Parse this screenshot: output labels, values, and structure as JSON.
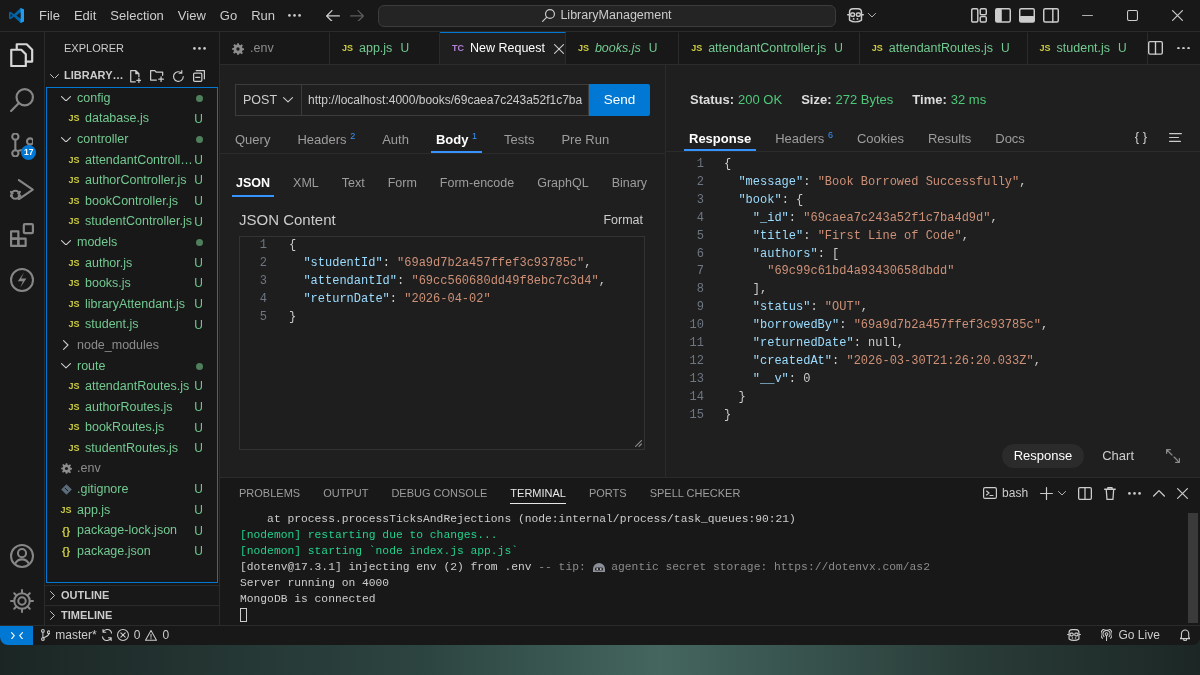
{
  "window": {
    "title": "LibraryManagement"
  },
  "menu": [
    "File",
    "Edit",
    "Selection",
    "View",
    "Go",
    "Run"
  ],
  "nav_buttons": [
    {
      "kind": "back",
      "disabled": false
    },
    {
      "kind": "forward",
      "disabled": true
    }
  ],
  "layout_toggles": [
    {
      "kind": "customize"
    },
    {
      "kind": "primary_sidebar",
      "on": true
    },
    {
      "kind": "panel",
      "on": true
    },
    {
      "kind": "secondary_sidebar",
      "on": false
    }
  ],
  "activity_bar": {
    "items": [
      {
        "kind": "explorer",
        "selected": true
      },
      {
        "kind": "search",
        "selected": false
      },
      {
        "kind": "source_control",
        "selected": false,
        "badge": "17"
      },
      {
        "kind": "run_debug",
        "selected": false
      },
      {
        "kind": "extensions",
        "selected": false
      },
      {
        "kind": "thunder_client",
        "selected": false
      }
    ],
    "bottom": [
      {
        "kind": "account"
      },
      {
        "kind": "settings"
      }
    ]
  },
  "sidebar": {
    "title": "EXPLORER",
    "root": {
      "label": "LIBRARY…",
      "expanded": true,
      "children": [
        {
          "kind": "folder",
          "label": "config",
          "expanded": true,
          "ignored": false,
          "children": [
            {
              "kind": "js",
              "icon": "JS",
              "label": "database.js",
              "ignored": false,
              "badge": "U"
            }
          ]
        },
        {
          "kind": "folder",
          "label": "controller",
          "expanded": true,
          "ignored": false,
          "children": [
            {
              "kind": "js",
              "icon": "JS",
              "label": "attendantControll…",
              "ignored": false,
              "badge": "U"
            },
            {
              "kind": "js",
              "icon": "JS",
              "label": "authorController.js",
              "ignored": false,
              "badge": "U"
            },
            {
              "kind": "js",
              "icon": "JS",
              "label": "bookController.js",
              "ignored": false,
              "badge": "U"
            },
            {
              "kind": "js",
              "icon": "JS",
              "label": "studentController.js",
              "ignored": false,
              "badge": "U"
            }
          ]
        },
        {
          "kind": "folder",
          "label": "models",
          "expanded": true,
          "ignored": false,
          "children": [
            {
              "kind": "js",
              "icon": "JS",
              "label": "author.js",
              "ignored": false,
              "badge": "U"
            },
            {
              "kind": "js",
              "icon": "JS",
              "label": "books.js",
              "ignored": false,
              "badge": "U"
            },
            {
              "kind": "js",
              "icon": "JS",
              "label": "libraryAttendant.js",
              "ignored": false,
              "badge": "U"
            },
            {
              "kind": "js",
              "icon": "JS",
              "label": "student.js",
              "ignored": false,
              "badge": "U"
            }
          ]
        },
        {
          "kind": "folder",
          "label": "node_modules",
          "expanded": false,
          "ignored": true
        },
        {
          "kind": "folder",
          "label": "route",
          "expanded": true,
          "ignored": false,
          "children": [
            {
              "kind": "js",
              "icon": "JS",
              "label": "attendantRoutes.js",
              "ignored": false,
              "badge": "U"
            },
            {
              "kind": "js",
              "icon": "JS",
              "label": "authorRoutes.js",
              "ignored": false,
              "badge": "U"
            },
            {
              "kind": "js",
              "icon": "JS",
              "label": "bookRoutes.js",
              "ignored": false,
              "badge": "U"
            },
            {
              "kind": "js",
              "icon": "JS",
              "label": "studentRoutes.js",
              "ignored": false,
              "badge": "U"
            }
          ]
        },
        {
          "kind": "env",
          "label": ".env",
          "ignored": true
        },
        {
          "kind": "git",
          "label": ".gitignore",
          "ignored": false,
          "badge": "U"
        },
        {
          "kind": "js",
          "icon": "JS",
          "label": "app.js",
          "ignored": false,
          "badge": "U"
        },
        {
          "kind": "json",
          "icon": "{}",
          "label": "package-lock.json",
          "ignored": false,
          "badge": "U"
        },
        {
          "kind": "json",
          "icon": "{}",
          "label": "package.json",
          "ignored": false,
          "badge": "U"
        }
      ]
    },
    "sections": [
      {
        "label": "OUTLINE",
        "expanded": false
      },
      {
        "label": "TIMELINE",
        "expanded": false
      }
    ]
  },
  "tabs": [
    {
      "kind": "env",
      "label": ".env",
      "ignored": true,
      "preview": false,
      "selected": false
    },
    {
      "kind": "js",
      "icon": "JS",
      "label": "app.js",
      "ignored": false,
      "badge": "U",
      "preview": false,
      "selected": false
    },
    {
      "kind": "request",
      "icon": "TC",
      "label": "New Request",
      "preview": false,
      "selected": true
    },
    {
      "kind": "js",
      "icon": "JS",
      "label": "books.js",
      "ignored": false,
      "badge": "U",
      "preview": true,
      "selected": false
    },
    {
      "kind": "js",
      "icon": "JS",
      "label": "attendantController.js",
      "ignored": false,
      "badge": "U",
      "preview": false,
      "selected": false
    },
    {
      "kind": "js",
      "icon": "JS",
      "label": "attendantRoutes.js",
      "ignored": false,
      "badge": "U",
      "preview": false,
      "selected": false
    },
    {
      "kind": "js",
      "icon": "JS",
      "label": "student.js",
      "ignored": false,
      "badge": "U",
      "preview": false,
      "selected": false
    }
  ],
  "request": {
    "method": "POST",
    "url": "http://localhost:4000/books/69caea7c243a52f1c7ba",
    "send": "Send",
    "tabs": [
      {
        "label": "Query",
        "selected": false
      },
      {
        "label": "Headers",
        "count": "2",
        "selected": false
      },
      {
        "label": "Auth",
        "selected": false
      },
      {
        "label": "Body",
        "count": "1",
        "selected": true
      },
      {
        "label": "Tests",
        "selected": false
      },
      {
        "label": "Pre Run",
        "selected": false
      }
    ],
    "body_types": [
      {
        "label": "JSON",
        "selected": true
      },
      {
        "label": "XML",
        "selected": false
      },
      {
        "label": "Text",
        "selected": false
      },
      {
        "label": "Form",
        "selected": false
      },
      {
        "label": "Form-encode",
        "selected": false
      },
      {
        "label": "GraphQL",
        "selected": false
      },
      {
        "label": "Binary",
        "selected": false
      }
    ],
    "content_label": "JSON Content",
    "format": "Format",
    "lines": [
      {
        "number": "1",
        "text": "{"
      },
      {
        "number": "2",
        "text": "  \"studentId\": \"69a9d7b2a457ffef3c93785c\","
      },
      {
        "number": "3",
        "text": "  \"attendantId\": \"69cc560680dd49f8ebc7c3d4\","
      },
      {
        "number": "4",
        "text": "  \"returnDate\": \"2026-04-02\""
      },
      {
        "number": "5",
        "text": "}"
      }
    ]
  },
  "response": {
    "stats": [
      {
        "label": "Status:",
        "value": "200 OK"
      },
      {
        "label": "Size:",
        "value": "272 Bytes"
      },
      {
        "label": "Time:",
        "value": "32 ms"
      }
    ],
    "tabs": [
      {
        "label": "Response",
        "selected": true
      },
      {
        "label": "Headers",
        "count": "6",
        "selected": false
      },
      {
        "label": "Cookies",
        "selected": false
      },
      {
        "label": "Results",
        "selected": false
      },
      {
        "label": "Docs",
        "selected": false
      }
    ],
    "json_toggle": "{ }",
    "lines": [
      {
        "number": "1",
        "text": "{"
      },
      {
        "number": "2",
        "text": "  \"message\": \"Book Borrowed Successfully\","
      },
      {
        "number": "3",
        "text": "  \"book\": {"
      },
      {
        "number": "4",
        "text": "    \"_id\": \"69caea7c243a52f1c7ba4d9d\","
      },
      {
        "number": "5",
        "text": "    \"title\": \"First Line of Code\","
      },
      {
        "number": "6",
        "text": "    \"authors\": ["
      },
      {
        "number": "7",
        "text": "      \"69c99c61bd4a93430658dbdd\""
      },
      {
        "number": "8",
        "text": "    ],"
      },
      {
        "number": "9",
        "text": "    \"status\": \"OUT\","
      },
      {
        "number": "10",
        "text": "    \"borrowedBy\": \"69a9d7b2a457ffef3c93785c\","
      },
      {
        "number": "11",
        "text": "    \"returnedDate\": null,"
      },
      {
        "number": "12",
        "text": "    \"createdAt\": \"2026-03-30T21:26:20.033Z\","
      },
      {
        "number": "13",
        "text": "    \"__v\": 0"
      },
      {
        "number": "14",
        "text": "  }"
      },
      {
        "number": "15",
        "text": "}"
      }
    ],
    "views": [
      {
        "label": "Response",
        "selected": true
      },
      {
        "label": "Chart",
        "selected": false
      }
    ]
  },
  "panel": {
    "tabs": [
      {
        "label": "PROBLEMS",
        "selected": false
      },
      {
        "label": "OUTPUT",
        "selected": false
      },
      {
        "label": "DEBUG CONSOLE",
        "selected": false
      },
      {
        "label": "TERMINAL",
        "selected": true
      },
      {
        "label": "PORTS",
        "selected": false
      },
      {
        "label": "SPELL CHECKER",
        "selected": false
      }
    ],
    "shell": "bash",
    "terminal": [
      {
        "segments": [
          {
            "kind": "plain",
            "text": "    at process.processTicksAndRejections (node:internal/process/task_queues:90:21)"
          }
        ]
      },
      {
        "segments": [
          {
            "kind": "success",
            "text": "[nodemon] restarting due to changes..."
          }
        ]
      },
      {
        "segments": [
          {
            "kind": "success",
            "text": "[nodemon] starting `node index.js app.js`"
          }
        ]
      },
      {
        "segments": [
          {
            "kind": "plain",
            "text": "[dotenv@17.3.1] injecting env (2) from .env"
          },
          {
            "kind": "muted",
            "text": "-- tip:"
          },
          {
            "kind": "emoji"
          },
          {
            "kind": "muted",
            "text": "agentic secret storage: https://dotenvx.com/as2"
          }
        ]
      },
      {
        "segments": [
          {
            "kind": "plain",
            "text": "Server running on 4000"
          }
        ]
      },
      {
        "segments": [
          {
            "kind": "plain",
            "text": "MongoDB is connected"
          }
        ]
      }
    ],
    "cursor": true
  },
  "status_bar": {
    "branch": "master*",
    "errors": "0",
    "warnings": "0",
    "go_live": "Go Live"
  }
}
